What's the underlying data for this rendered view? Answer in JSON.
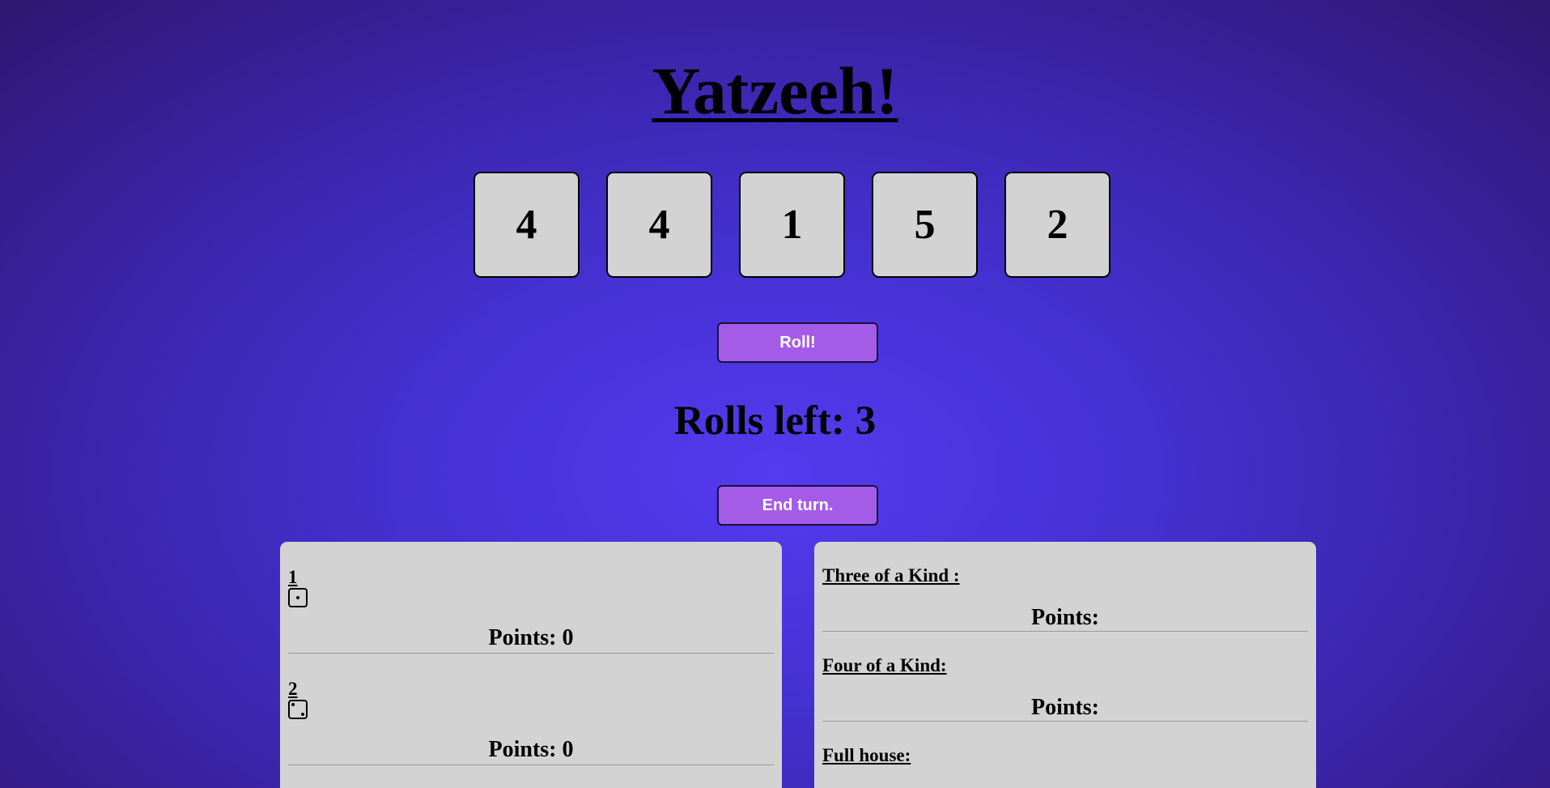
{
  "title": "Yatzeeh!",
  "dice": [
    {
      "value": "4"
    },
    {
      "value": "4"
    },
    {
      "value": "1"
    },
    {
      "value": "5"
    },
    {
      "value": "2"
    }
  ],
  "roll_button": {
    "label": "Roll!"
  },
  "rolls_left": {
    "text": "Rolls left: 3"
  },
  "end_turn_button": {
    "label": "End turn."
  },
  "upper_section": [
    {
      "label": "1",
      "face_icon": "die-face-1-icon",
      "points": "Points: 0"
    },
    {
      "label": "2",
      "face_icon": "die-face-2-icon",
      "points": "Points: 0"
    }
  ],
  "lower_section": [
    {
      "label": "Three of a Kind :",
      "points": "Points:"
    },
    {
      "label": "Four of a Kind:",
      "points": "Points:"
    },
    {
      "label": "Full house:",
      "points": ""
    }
  ],
  "colors": {
    "background_center": "#553af0",
    "background_edge": "#2e1670",
    "die_face": "#d3d3d3",
    "button": "#a45ce8",
    "panel": "#d3d3d3"
  }
}
